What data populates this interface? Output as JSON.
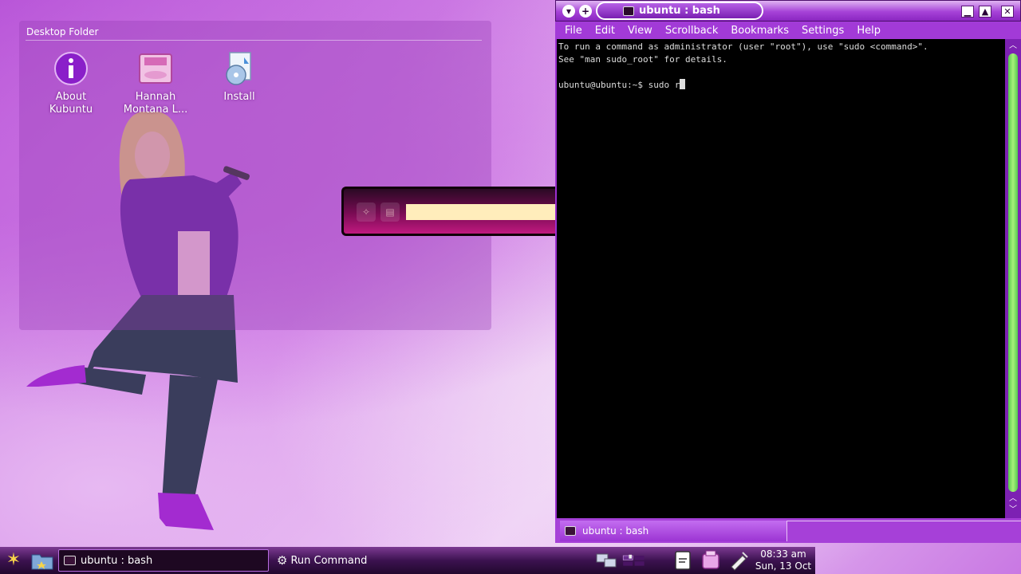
{
  "desktop": {
    "folder_title": "Desktop Folder",
    "icons": [
      {
        "label_line1": "About",
        "label_line2": "Kubuntu",
        "icon": "info-icon"
      },
      {
        "label_line1": "Hannah",
        "label_line2": "Montana L...",
        "icon": "disc-case-icon"
      },
      {
        "label_line1": "Install",
        "label_line2": "",
        "icon": "install-cd-icon"
      }
    ]
  },
  "run_command_dialog": {
    "input_value": ""
  },
  "terminal": {
    "title": "ubuntu : bash",
    "menu": [
      "File",
      "Edit",
      "View",
      "Scrollback",
      "Bookmarks",
      "Settings",
      "Help"
    ],
    "lines": [
      "To run a command as administrator (user \"root\"), use \"sudo <command>\".",
      "See \"man sudo_root\" for details.",
      "",
      "ubuntu@ubuntu:~$ sudo r"
    ],
    "session_tab": "ubuntu : bash"
  },
  "taskbar": {
    "tasks": [
      {
        "label": "ubuntu : bash",
        "active": true
      },
      {
        "label": "Run Command",
        "active": false
      }
    ],
    "clock_time": "08:33 am",
    "clock_date": "Sun, 13 Oct"
  },
  "colors": {
    "accent": "#a23ad7",
    "terminal_bg": "#000000",
    "scroll_thumb": "#7fe06a",
    "run_input_bg": "#ffedbb"
  }
}
